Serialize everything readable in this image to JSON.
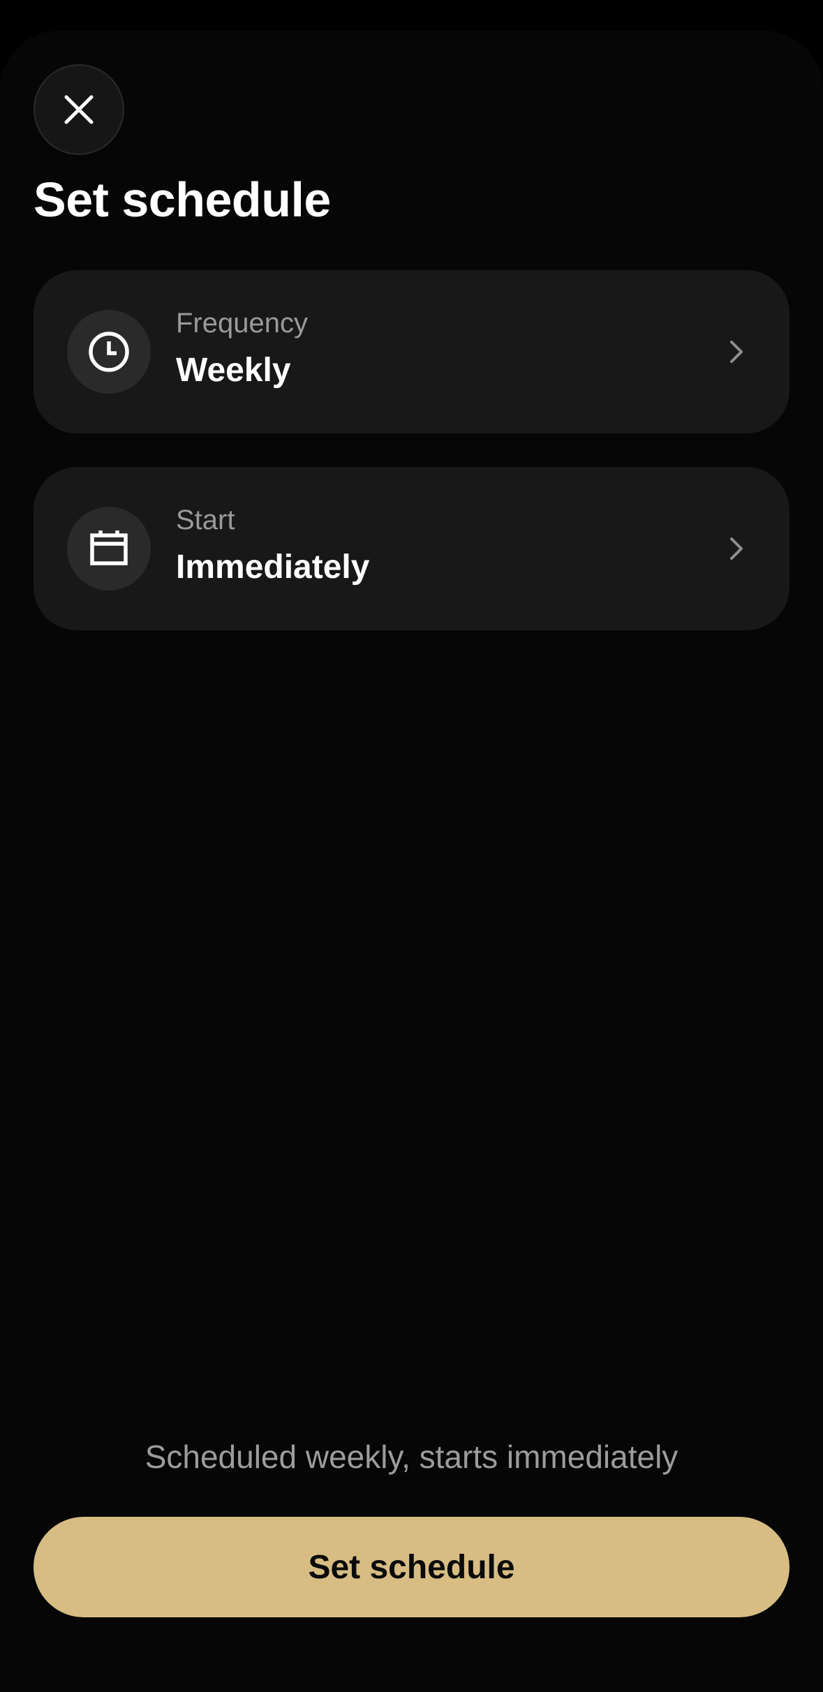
{
  "header": {
    "title": "Set schedule",
    "close_icon": "close-icon"
  },
  "settings": [
    {
      "label": "Frequency",
      "value": "Weekly",
      "icon": "clock-icon"
    },
    {
      "label": "Start",
      "value": "Immediately",
      "icon": "calendar-icon"
    }
  ],
  "footer": {
    "summary": "Scheduled weekly, starts immediately",
    "button_label": "Set schedule"
  },
  "colors": {
    "background": "#060606",
    "card": "#181818",
    "accent": "#d7bd84",
    "muted_text": "#9a9a9a"
  }
}
